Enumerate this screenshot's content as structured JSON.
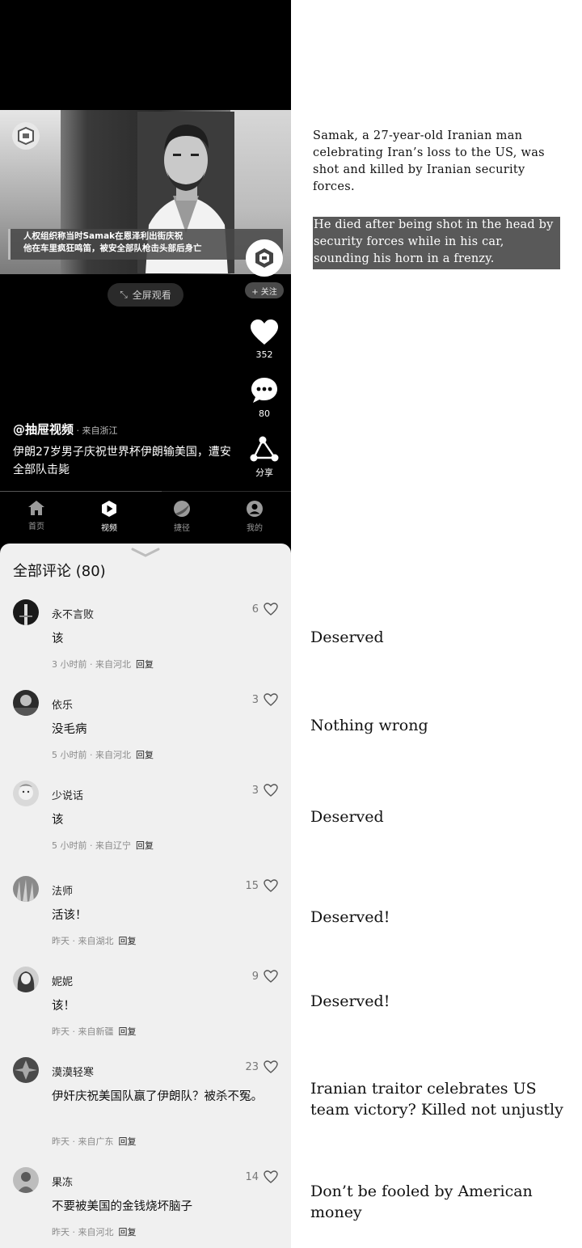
{
  "video": {
    "caption_line1": "人权组织称当时Samak在恩泽利出街庆祝",
    "caption_line2": "他在车里疯狂鸣笛，被安全部队枪击头部后身亡",
    "fullscreen_label": "全屏观看",
    "follow_label": "+ 关注",
    "uploader": "@抽屉视频",
    "uploader_from": " · 来自浙江",
    "description": "伊朗27岁男子庆祝世界杯伊朗输美国，遭安全部队击毙",
    "likes": "352",
    "comments": "80",
    "share_label": "分享"
  },
  "nav": {
    "items": [
      {
        "label": "首页",
        "icon": "home-icon"
      },
      {
        "label": "视频",
        "icon": "video-play-icon"
      },
      {
        "label": "捷径",
        "icon": "shortcut-icon"
      },
      {
        "label": "我的",
        "icon": "profile-icon"
      }
    ]
  },
  "comments_sheet": {
    "title": "全部评论 (80)",
    "reply_label": "回复",
    "comments": [
      {
        "name": "永不言败",
        "likes": "6",
        "text": "该",
        "meta": "3 小时前 · 来自河北",
        "translation": "Deserved"
      },
      {
        "name": "依乐",
        "likes": "3",
        "text": "没毛病",
        "meta": "5 小时前 · 来自河北",
        "translation": "Nothing wrong"
      },
      {
        "name": "少说话",
        "likes": "3",
        "text": "该",
        "meta": "5 小时前 · 来自辽宁",
        "translation": "Deserved"
      },
      {
        "name": "法师",
        "likes": "15",
        "text": "活该！",
        "meta": "昨天 · 来自湖北",
        "translation": "Deserved!"
      },
      {
        "name": "妮妮",
        "likes": "9",
        "text": "该！",
        "meta": "昨天 · 来自新疆",
        "translation": "Deserved!"
      },
      {
        "name": "漠漠轻寒",
        "likes": "23",
        "text": "伊奸庆祝美国队赢了伊朗队？被杀不冤。",
        "meta": "昨天 · 来自广东",
        "translation": "Iranian traitor celebrates US team victory? Killed not unjustly"
      },
      {
        "name": "果冻",
        "likes": "14",
        "text": "不要被美国的金钱烧坏脑子",
        "meta": "昨天 · 来自河北",
        "translation": "Don’t be fooled by American money"
      }
    ]
  },
  "translation": {
    "summary": "Samak, a 27-year-old Iranian man celebrating Iran’s loss to the US, was shot and killed by Iranian security forces.",
    "caption_translation": "He died after being shot in the head by security forces while in his car, sounding his horn in a frenzy."
  }
}
